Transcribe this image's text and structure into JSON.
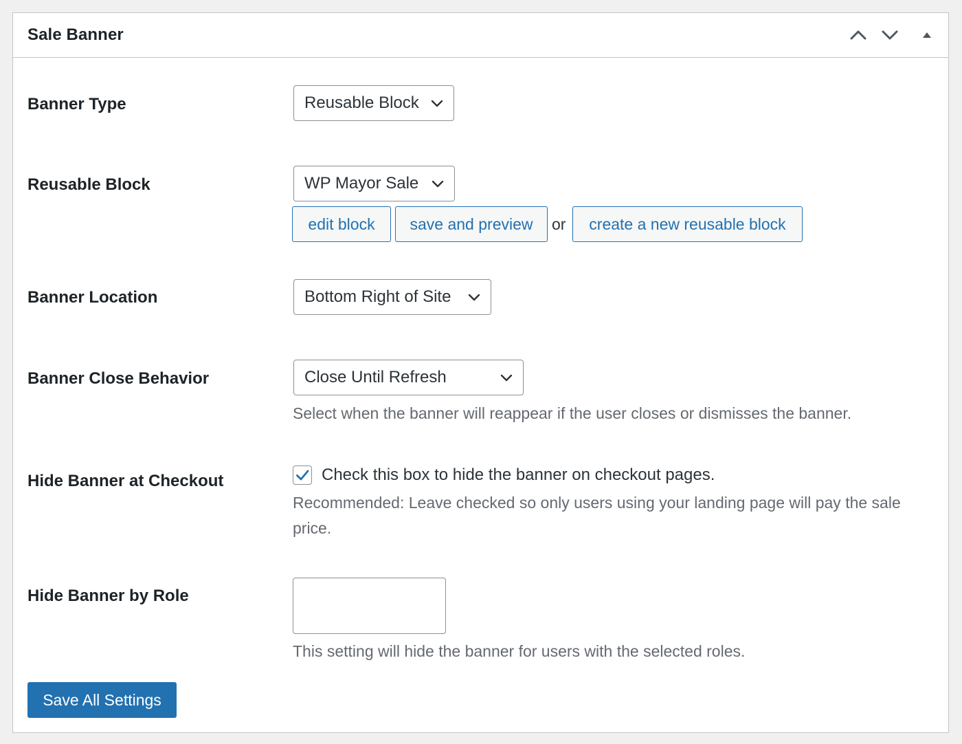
{
  "panel": {
    "title": "Sale Banner",
    "controls": [
      "chevron-up-icon",
      "chevron-down-icon",
      "triangle-up-icon"
    ]
  },
  "fields": {
    "banner_type": {
      "label": "Banner Type",
      "value": "Reusable Block"
    },
    "reusable_block": {
      "label": "Reusable Block",
      "value": "WP Mayor Sale",
      "edit_label": "edit block",
      "save_preview_label": "save and preview",
      "or_text": "or",
      "create_label": "create a new reusable block"
    },
    "banner_location": {
      "label": "Banner Location",
      "value": "Bottom Right of Site"
    },
    "close_behavior": {
      "label": "Banner Close Behavior",
      "value": "Close Until Refresh",
      "description": "Select when the banner will reappear if the user closes or dismisses the banner."
    },
    "hide_checkout": {
      "label": "Hide Banner at Checkout",
      "checked": true,
      "checkbox_label": "Check this box to hide the banner on checkout pages.",
      "description": "Recommended: Leave checked so only users using your landing page will pay the sale price."
    },
    "hide_role": {
      "label": "Hide Banner by Role",
      "value": "",
      "description": "This setting will hide the banner for users with the selected roles."
    }
  },
  "actions": {
    "save_label": "Save All Settings"
  },
  "colors": {
    "primary": "#2271b1",
    "text": "#1d2327",
    "muted": "#646970",
    "border": "#8c8f94",
    "background": "#f0f0f1"
  }
}
